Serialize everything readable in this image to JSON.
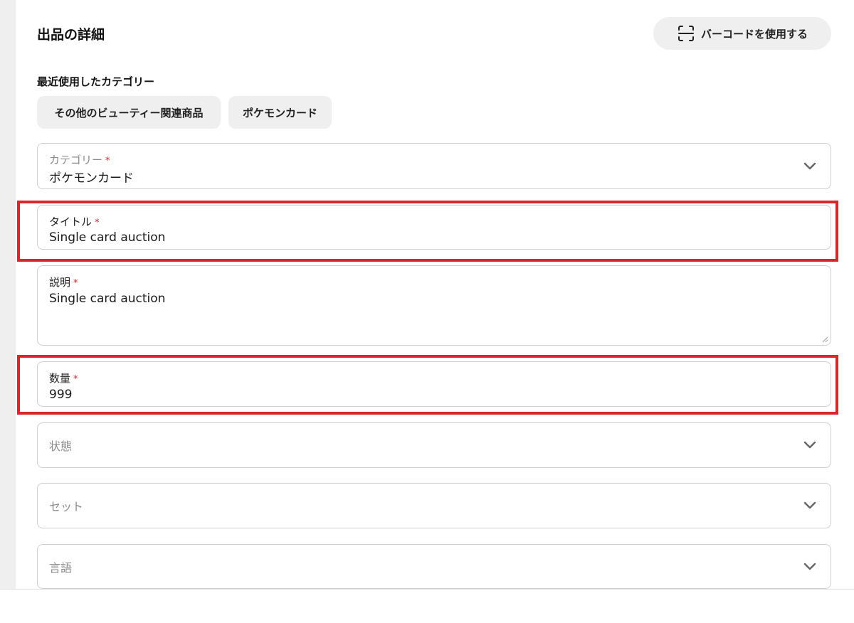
{
  "header": {
    "title": "出品の詳細",
    "barcode_button_label": "バーコードを使用する"
  },
  "recent_categories": {
    "label": "最近使用したカテゴリー",
    "chips": [
      "その他のビューティー関連商品",
      "ポケモンカード"
    ]
  },
  "form": {
    "category": {
      "label": "カテゴリー",
      "required_mark": "*",
      "value": "ポケモンカード"
    },
    "title": {
      "label": "タイトル",
      "required_mark": "*",
      "value": "Single card auction"
    },
    "description": {
      "label": "説明",
      "required_mark": "*",
      "value": "Single card auction"
    },
    "quantity": {
      "label": "数量",
      "required_mark": "*",
      "value": "999"
    },
    "condition": {
      "placeholder": "状態"
    },
    "set": {
      "placeholder": "セット"
    },
    "language": {
      "placeholder": "言語"
    }
  },
  "icons": {
    "barcode": "barcode-scan-icon",
    "dropdown": "chevron-down-icon"
  },
  "colors": {
    "highlight": "#d9262b",
    "required": "#d9262b",
    "chip_bg": "#efefef"
  }
}
